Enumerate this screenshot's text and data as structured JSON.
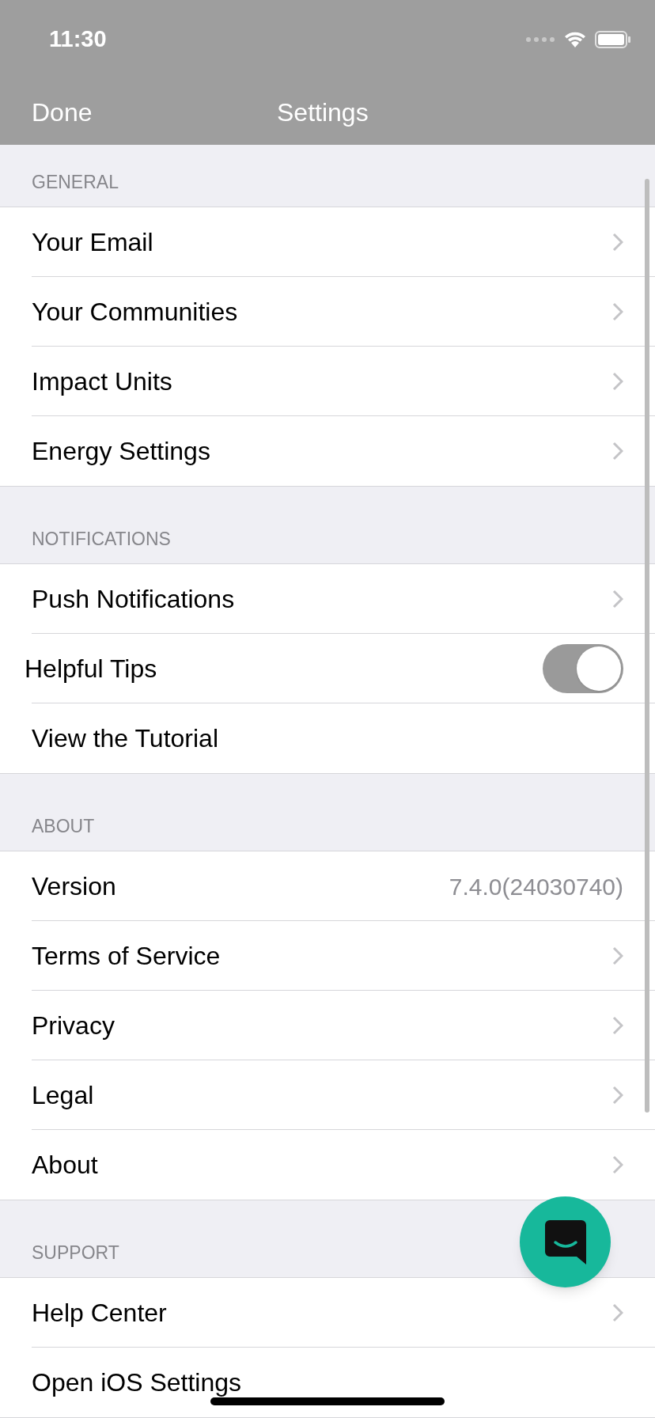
{
  "status_bar": {
    "time": "11:30"
  },
  "nav_bar": {
    "left_button": "Done",
    "title": "Settings"
  },
  "sections": [
    {
      "header": "GENERAL",
      "rows": [
        {
          "kind": "link",
          "label": "Your Email"
        },
        {
          "kind": "link",
          "label": "Your Communities"
        },
        {
          "kind": "link",
          "label": "Impact Units"
        },
        {
          "kind": "link",
          "label": "Energy Settings"
        }
      ]
    },
    {
      "header": "NOTIFICATIONS",
      "rows": [
        {
          "kind": "link",
          "label": "Push Notifications"
        },
        {
          "kind": "toggle",
          "label": "Helpful Tips",
          "on": true
        },
        {
          "kind": "plain",
          "label": "View the Tutorial"
        }
      ]
    },
    {
      "header": "ABOUT",
      "rows": [
        {
          "kind": "value",
          "label": "Version",
          "value": "7.4.0(24030740)"
        },
        {
          "kind": "link",
          "label": "Terms of Service"
        },
        {
          "kind": "link",
          "label": "Privacy"
        },
        {
          "kind": "link",
          "label": "Legal"
        },
        {
          "kind": "link",
          "label": "About"
        }
      ]
    },
    {
      "header": "SUPPORT",
      "rows": [
        {
          "kind": "link",
          "label": "Help Center"
        },
        {
          "kind": "plain",
          "label": "Open iOS Settings"
        }
      ]
    }
  ]
}
